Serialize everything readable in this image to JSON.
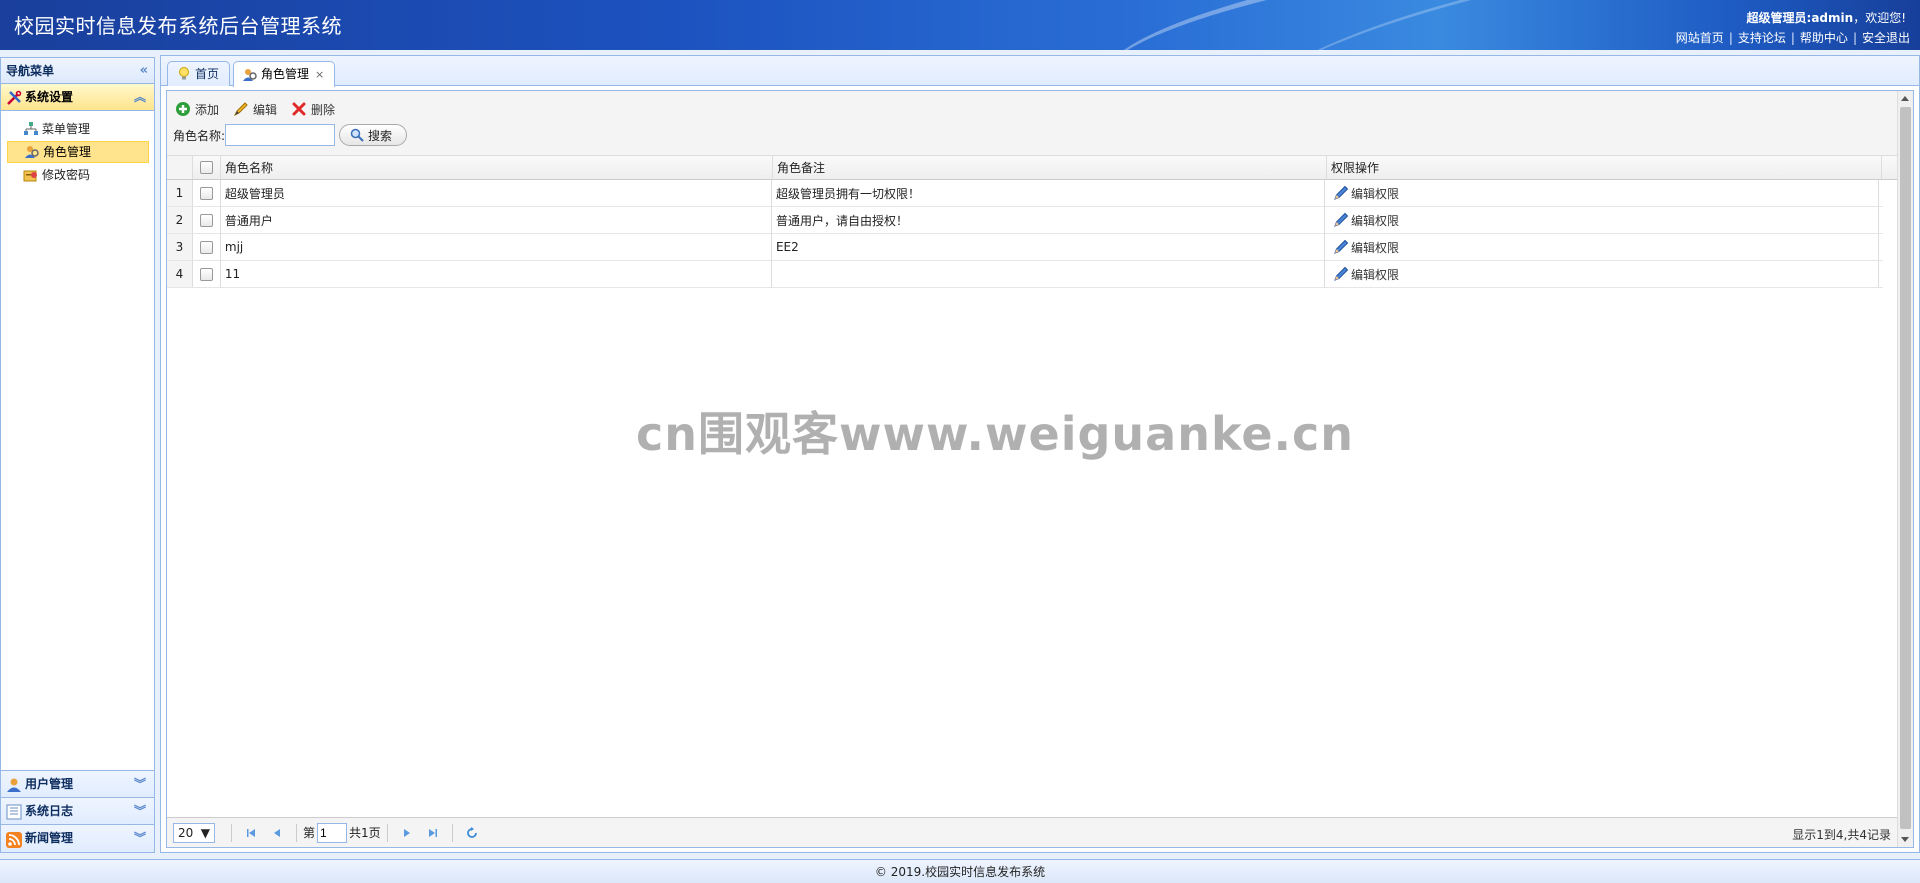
{
  "header": {
    "title": "校园实时信息发布系统后台管理系统",
    "welcome_prefix": "超级管理员:admin",
    "welcome_suffix": "，欢迎您!",
    "links": [
      "网站首页",
      "支持论坛",
      "帮助中心",
      "安全退出"
    ]
  },
  "sidebar": {
    "title": "导航菜单",
    "active_group": "系统设置",
    "items": [
      {
        "label": "菜单管理",
        "icon": "tree-icon"
      },
      {
        "label": "角色管理",
        "icon": "role-icon"
      },
      {
        "label": "修改密码",
        "icon": "password-icon"
      }
    ],
    "groups": [
      {
        "label": "用户管理",
        "icon": "user-icon"
      },
      {
        "label": "系统日志",
        "icon": "log-icon"
      },
      {
        "label": "新闻管理",
        "icon": "rss-icon"
      }
    ]
  },
  "tabs": [
    {
      "label": "首页",
      "icon": "bulb-icon"
    },
    {
      "label": "角色管理",
      "icon": "role-icon",
      "close": "×"
    }
  ],
  "toolbar": {
    "add": "添加",
    "edit": "编辑",
    "delete": "删除"
  },
  "search": {
    "label": "角色名称:",
    "value": "",
    "button": "搜索"
  },
  "grid": {
    "columns": [
      "角色名称",
      "角色备注",
      "权限操作"
    ],
    "rows": [
      {
        "num": "1",
        "name": "超级管理员",
        "remark": "超级管理员拥有一切权限！",
        "op": "编辑权限"
      },
      {
        "num": "2",
        "name": "普通用户",
        "remark": "普通用户，请自由授权！",
        "op": "编辑权限"
      },
      {
        "num": "3",
        "name": "mjj",
        "remark": "EE2",
        "op": "编辑权限"
      },
      {
        "num": "4",
        "name": "11",
        "remark": "",
        "op": "编辑权限"
      }
    ]
  },
  "pager": {
    "page_size": "20",
    "page_prefix": "第",
    "page_value": "1",
    "page_total": "共1页",
    "info": "显示1到4,共4记录"
  },
  "footer": {
    "text": "© 2019.校园实时信息发布系统"
  },
  "watermark": "cn围观客www.weiguanke.cn"
}
